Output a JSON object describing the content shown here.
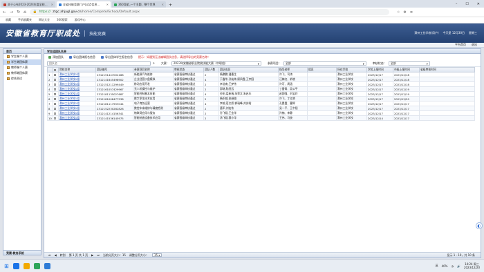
{
  "browser": {
    "tabs": [
      {
        "title": "关于公布2023-2024年度全校...",
        "color": "#c0392b",
        "active": false
      },
      {
        "title": "全省技能竞赛门户|试点信息...",
        "color": "#2e7bd6",
        "active": true
      },
      {
        "title": "360导航_一个主题、整个世界",
        "color": "#2ea55a",
        "active": false
      }
    ],
    "new_tab": "+",
    "window_controls": [
      "–",
      "☐",
      "✕"
    ],
    "address": {
      "scheme": "https://",
      "host": "ztgc.ahjygl.gov.cn",
      "path": "/home/Compete/School/Default.aspx"
    },
    "bookmarks": [
      "收藏",
      "手机收藏夹",
      "网址大全",
      "360搜索",
      "游戏中心"
    ]
  },
  "header": {
    "brand": "安徽省教育厅职成处",
    "system": "技能竞赛",
    "user": [
      "滁州工业学校(用户)",
      "今天是 12月30日",
      "星期三"
    ],
    "nav": [
      "平台首页",
      "退出"
    ]
  },
  "sidebar": {
    "title": "首页",
    "items": [
      {
        "label": "学生端个人赛",
        "active": false
      },
      {
        "label": "学生端团体赛",
        "active": true
      },
      {
        "label": "教师端个人赛",
        "active": false
      },
      {
        "label": "教师端团体赛",
        "active": false
      },
      {
        "label": "综合测试",
        "active": false
      }
    ],
    "footer": "竞赛-教务系统"
  },
  "panel": {
    "title": "学生组团队名单",
    "toolbar": {
      "add": "添加团队",
      "export_team": "导出团体报名信息",
      "export_student": "导出团体学生报名信息",
      "warning": "提示：如遇到无法编辑团队信息，请选择导出的竞赛名称！"
    },
    "filters": {
      "search_placeholder": "团队名",
      "event_label": "大赛：",
      "event_value": "2023年安徽省职业院校技能大赛（中职组）",
      "category_label": "参赛项目：",
      "category_value": "全部",
      "status_label": "审核状态：",
      "status_value": "全部"
    },
    "table": {
      "columns": [
        "",
        "",
        "院校名称",
        "团队编号",
        "参赛项目名称",
        "审核状态",
        "团队人数",
        "团队成员",
        "指导老师",
        "组员",
        "所在学校",
        "学校上报时间",
        "市级上报时间",
        "省级审核时间"
      ],
      "rows": [
        [
          "1",
          "滁州工业学校1组",
          "2312151447004188",
          "新能源汽车维修",
          "省赛晋级审核通过",
          "2",
          "杨鹏鹏,潘墨生",
          "许飞、司涛",
          "",
          "滁州工业学校",
          "2023/12/17",
          "2023/12/18",
          ""
        ],
        [
          "2",
          "滁州工业学校1组",
          "2312141645498902",
          "企业经营沙盘模拟",
          "省赛晋级审核通过",
          "4",
          "于鑫华,孙灿帅,顾凤霞,王宗园",
          "汪梅红、俞晓",
          "",
          "滁州工业学校",
          "2023/12/17",
          "2023/12/18",
          ""
        ],
        [
          "3",
          "滁州工业学校1组",
          "2312151211299449",
          "移动应用开发",
          "省赛晋级审核通过",
          "2",
          "李浩南,王梦伟",
          "许可、周涵",
          "",
          "滁州工业学校",
          "2023/12/17",
          "2023/12/18",
          ""
        ],
        [
          "4",
          "滁州工业学校1组",
          "2312161057429967",
          "无人机操控与维护",
          "省赛晋级审核通过",
          "2",
          "邱瑞,陆恒远",
          "丁雷青、吴公平",
          "",
          "滁州工业学校",
          "2023/12/17",
          "2023/12/19",
          ""
        ],
        [
          "5",
          "滁州工业学校1组",
          "2312181135027687",
          "智能控制基本技能",
          "省赛晋级审核通过",
          "4",
          "孙阳,葛新瑞,朱荣文,朱启乐",
          "赵国强、刘宝玲",
          "",
          "滁州工业学校",
          "2023/12/17",
          "2023/12/19",
          ""
        ],
        [
          "6",
          "滁州工业学校1组",
          "2312181008477538",
          "数字孪生技术应用",
          "省赛晋级审核通过",
          "2",
          "杨积威,张继雄",
          "许飞、丁红艳",
          "",
          "滁州工业学校",
          "2023/12/17",
          "2023/12/20",
          ""
        ],
        [
          "7",
          "滁州工业学校1组",
          "2312181117553044",
          "电子商务运营",
          "省赛晋级审核通过",
          "4",
          "李婉,葛文娇,郭瑞峰,刘苏晗",
          "孔晨霞、曹辉",
          "",
          "滁州工业学校",
          "2023/12/17",
          "2023/12/17",
          ""
        ],
        [
          "8",
          "滁州工业学校1组",
          "2312152230282828",
          "数控车床维修与精度检测",
          "省赛晋级审核通过",
          "2",
          "唐军,刘宏伟",
          "吴一平、王中阳",
          "",
          "滁州工业学校",
          "2023/12/17",
          "2023/12/17",
          ""
        ],
        [
          "9",
          "滁州工业学校1组",
          "2312141214156341",
          "物联网应用与服务",
          "省赛晋级审核通过",
          "2",
          "孙飞翔,王金华",
          "孙楠、李静",
          "",
          "滁州工业学校",
          "2023/12/17",
          "2023/12/17",
          ""
        ],
        [
          "10",
          "滁州工业学校1组",
          "2312141536145975",
          "智能制造设备技术应用",
          "省赛晋级审核通过",
          "2",
          "汤飞翔,薛小华",
          "王伟、马骁",
          "",
          "滁州工业学校",
          "2023/12/14",
          "2023/12/17",
          ""
        ]
      ]
    },
    "pager": {
      "goto_label": "转到",
      "page_info": "第 1 页 共 1 页",
      "page_size_label": "当前分页大小：15",
      "adjust_label": "调整分页大小：",
      "page_size": "15",
      "range": "显示 1 - 10，共 10 条"
    }
  },
  "taskbar": {
    "apps": [
      "#1a73e8",
      "#f2a900",
      "#2ea55a",
      "#2e7bd6"
    ],
    "tray": [
      "英",
      "40%"
    ],
    "time": "14:24 周三",
    "date": "2023/12/20"
  }
}
